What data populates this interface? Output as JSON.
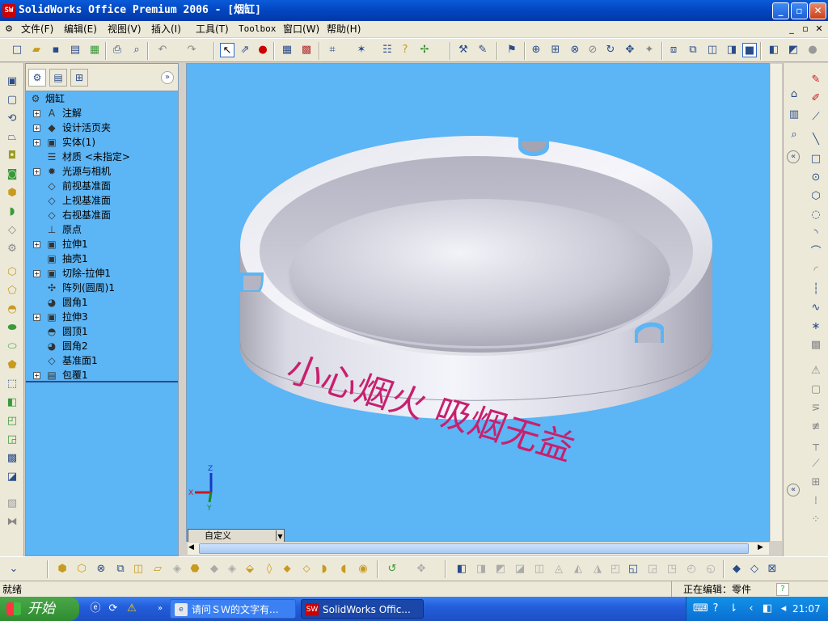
{
  "window": {
    "title": "SolidWorks Office Premium 2006 - [烟缸]",
    "app_logo": "SW",
    "minimize": "_",
    "restore": "▫",
    "close": "✕"
  },
  "menu": {
    "items": [
      {
        "label": "文件(F)"
      },
      {
        "label": "编辑(E)"
      },
      {
        "label": "视图(V)"
      },
      {
        "label": "插入(I)"
      },
      {
        "label": "工具(T)"
      },
      {
        "label": "Toolbox"
      },
      {
        "label": "窗口(W)"
      },
      {
        "label": "帮助(H)"
      }
    ],
    "doc_min": "_",
    "doc_restore": "▫",
    "doc_close": "✕"
  },
  "tree": {
    "root": "烟缸",
    "items": [
      {
        "label": "注解",
        "icon": "A",
        "expand": "+"
      },
      {
        "label": "设计活页夹",
        "icon": "◆",
        "expand": "+"
      },
      {
        "label": "实体(1)",
        "icon": "▣",
        "expand": "+"
      },
      {
        "label": "材质 <未指定>",
        "icon": "☰",
        "expand": ""
      },
      {
        "label": "光源与相机",
        "icon": "✹",
        "expand": "+"
      },
      {
        "label": "前视基准面",
        "icon": "◇",
        "expand": ""
      },
      {
        "label": "上视基准面",
        "icon": "◇",
        "expand": ""
      },
      {
        "label": "右视基准面",
        "icon": "◇",
        "expand": ""
      },
      {
        "label": "原点",
        "icon": "⊥",
        "expand": ""
      },
      {
        "label": "拉伸1",
        "icon": "▣",
        "expand": "+"
      },
      {
        "label": "抽壳1",
        "icon": "▣",
        "expand": ""
      },
      {
        "label": "切除-拉伸1",
        "icon": "▣",
        "expand": "+"
      },
      {
        "label": "阵列(圆周)1",
        "icon": "✣",
        "expand": ""
      },
      {
        "label": "圆角1",
        "icon": "◕",
        "expand": ""
      },
      {
        "label": "拉伸3",
        "icon": "▣",
        "expand": "+"
      },
      {
        "label": "圆顶1",
        "icon": "◓",
        "expand": ""
      },
      {
        "label": "圆角2",
        "icon": "◕",
        "expand": ""
      },
      {
        "label": "基准面1",
        "icon": "◇",
        "expand": ""
      },
      {
        "label": "包覆1",
        "icon": "▤",
        "expand": "+"
      }
    ]
  },
  "viewport": {
    "engraved_text": "小心烟火  吸烟无益",
    "view_orientation": "自定义",
    "axis_x": "X",
    "axis_y": "Y",
    "axis_z": "Z",
    "background_color": "#5cb5f5",
    "text_color": "#c8206e"
  },
  "status": {
    "ready": "就绪",
    "editing": "正在编辑：零件",
    "help": "?"
  },
  "taskbar": {
    "start": "开始",
    "tasks": [
      {
        "label": "请问ＳＷ的文字有..."
      },
      {
        "label": "SolidWorks Offic..."
      }
    ],
    "clock": "21:07"
  }
}
